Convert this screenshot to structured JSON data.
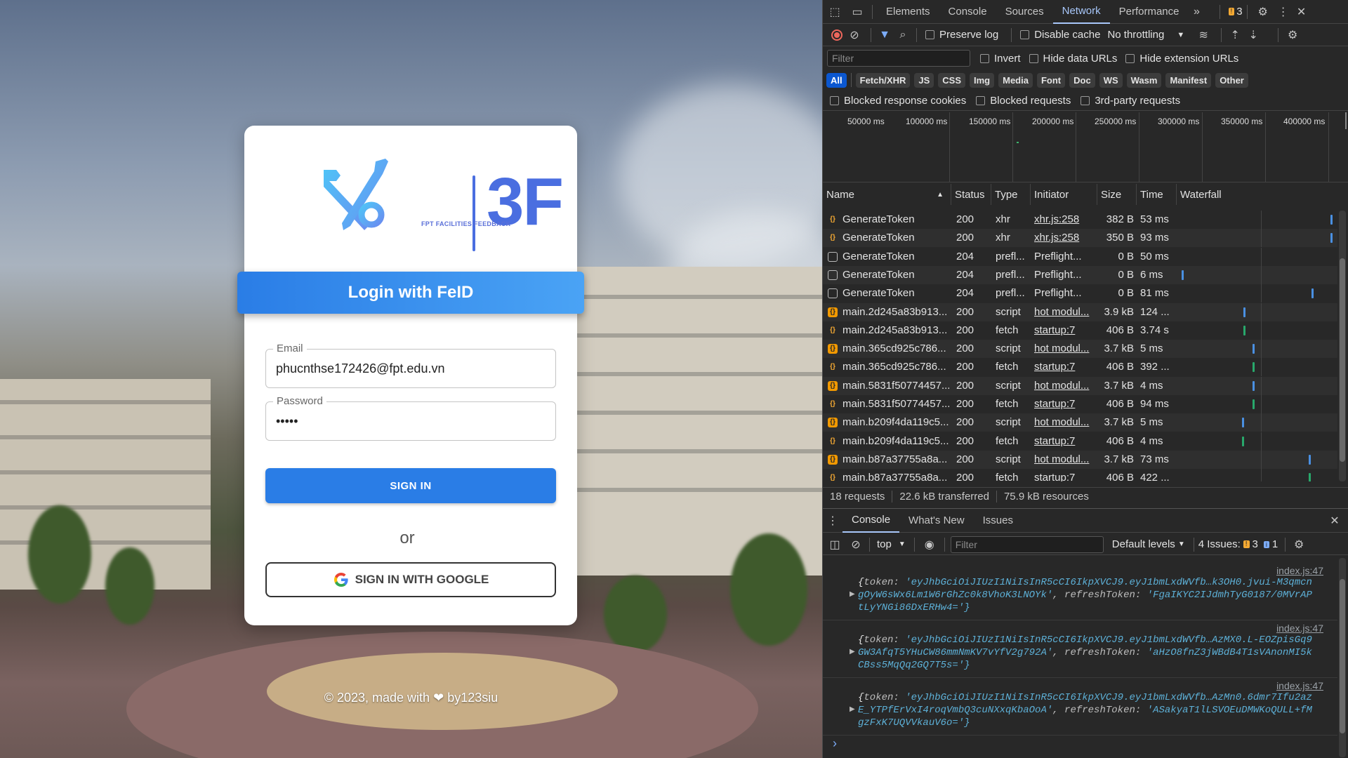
{
  "page": {
    "brand_logo": "3F",
    "brand_tagline": "FPT FACILITIES FEEDBACK",
    "banner_title": "Login with FeID",
    "email_label": "Email",
    "email_value": "phucnthse172426@fpt.edu.vn",
    "password_label": "Password",
    "password_value": "•••••",
    "signin_label": "SIGN IN",
    "or_text": "or",
    "google_label": "SIGN IN WITH GOOGLE",
    "footer_prefix": "© 2023, made with",
    "footer_suffix": "by123siu"
  },
  "devtools": {
    "tabs": [
      "Elements",
      "Console",
      "Sources",
      "Network",
      "Performance"
    ],
    "active_tab": "Network",
    "issues_count": "3",
    "toolbar": {
      "preserve_log": "Preserve log",
      "disable_cache": "Disable cache",
      "throttling": "No throttling"
    },
    "filter_placeholder": "Filter",
    "filter_options": {
      "invert": "Invert",
      "hide_data_urls": "Hide data URLs",
      "hide_extension_urls": "Hide extension URLs"
    },
    "type_chips": [
      "All",
      "Fetch/XHR",
      "JS",
      "CSS",
      "Img",
      "Media",
      "Font",
      "Doc",
      "WS",
      "Wasm",
      "Manifest",
      "Other"
    ],
    "request_options": {
      "blocked_cookies": "Blocked response cookies",
      "blocked_requests": "Blocked requests",
      "third_party": "3rd-party requests"
    },
    "timeline_ticks": [
      "50000 ms",
      "100000 ms",
      "150000 ms",
      "200000 ms",
      "250000 ms",
      "300000 ms",
      "350000 ms",
      "400000 ms"
    ],
    "columns": [
      "Name",
      "Status",
      "Type",
      "Initiator",
      "Size",
      "Time",
      "Waterfall"
    ],
    "rows": [
      {
        "name": "GenerateToken",
        "status": "200",
        "type": "xhr",
        "initiator": "xhr.js:258",
        "size": "382 B",
        "time": "53 ms",
        "icon": "xhr",
        "wf": 0.99
      },
      {
        "name": "GenerateToken",
        "status": "200",
        "type": "xhr",
        "initiator": "xhr.js:258",
        "size": "350 B",
        "time": "93 ms",
        "icon": "xhr",
        "wf": 0.99
      },
      {
        "name": "GenerateToken",
        "status": "204",
        "type": "prefl...",
        "initiator": "Preflight...",
        "size": "0 B",
        "time": "50 ms",
        "icon": "doc",
        "wf": null
      },
      {
        "name": "GenerateToken",
        "status": "204",
        "type": "prefl...",
        "initiator": "Preflight...",
        "size": "0 B",
        "time": "6 ms",
        "icon": "doc",
        "wf": 0.03
      },
      {
        "name": "GenerateToken",
        "status": "204",
        "type": "prefl...",
        "initiator": "Preflight...",
        "size": "0 B",
        "time": "81 ms",
        "icon": "doc",
        "wf": 0.87
      },
      {
        "name": "main.2d245a83b913...",
        "status": "200",
        "type": "script",
        "initiator": "hot modul...",
        "size": "3.9 kB",
        "time": "124 ...",
        "icon": "script",
        "wf": 0.43
      },
      {
        "name": "main.2d245a83b913...",
        "status": "200",
        "type": "fetch",
        "initiator": "startup:7",
        "size": "406 B",
        "time": "3.74 s",
        "icon": "xhr",
        "wf": 0.43
      },
      {
        "name": "main.365cd925c786...",
        "status": "200",
        "type": "script",
        "initiator": "hot modul...",
        "size": "3.7 kB",
        "time": "5 ms",
        "icon": "script",
        "wf": 0.49
      },
      {
        "name": "main.365cd925c786...",
        "status": "200",
        "type": "fetch",
        "initiator": "startup:7",
        "size": "406 B",
        "time": "392 ...",
        "icon": "xhr",
        "wf": 0.49
      },
      {
        "name": "main.5831f50774457...",
        "status": "200",
        "type": "script",
        "initiator": "hot modul...",
        "size": "3.7 kB",
        "time": "4 ms",
        "icon": "script",
        "wf": 0.49
      },
      {
        "name": "main.5831f50774457...",
        "status": "200",
        "type": "fetch",
        "initiator": "startup:7",
        "size": "406 B",
        "time": "94 ms",
        "icon": "xhr",
        "wf": 0.49
      },
      {
        "name": "main.b209f4da119c5...",
        "status": "200",
        "type": "script",
        "initiator": "hot modul...",
        "size": "3.7 kB",
        "time": "5 ms",
        "icon": "script",
        "wf": 0.42
      },
      {
        "name": "main.b209f4da119c5...",
        "status": "200",
        "type": "fetch",
        "initiator": "startup:7",
        "size": "406 B",
        "time": "4 ms",
        "icon": "xhr",
        "wf": 0.42
      },
      {
        "name": "main.b87a37755a8a...",
        "status": "200",
        "type": "script",
        "initiator": "hot modul...",
        "size": "3.7 kB",
        "time": "73 ms",
        "icon": "script",
        "wf": 0.85
      },
      {
        "name": "main.b87a37755a8a...",
        "status": "200",
        "type": "fetch",
        "initiator": "startup:7",
        "size": "406 B",
        "time": "422 ...",
        "icon": "xhr",
        "wf": 0.85
      }
    ],
    "summary": {
      "requests": "18 requests",
      "transferred": "22.6 kB transferred",
      "resources": "75.9 kB resources"
    },
    "drawer": {
      "tabs": [
        "Console",
        "What's New",
        "Issues"
      ],
      "context": "top",
      "filter_placeholder": "Filter",
      "levels": "Default levels",
      "issues_label": "4 Issues:",
      "warn_count": "3",
      "info_count": "1"
    },
    "logs": [
      {
        "src": "index.js:47",
        "line1_token": "'eyJhbGciOiJIUzI1NiIsInR5cCI6IkpXVCJ9.eyJ1bmLxdWVfb…k3OH0.jvui-M3qmcn",
        "line2_token": "gOyW6sWx6Lm1W6rGhZc0k8VhoK3LNOYk'",
        "line2_refresh": "'FgaIKYC2IJdmhTyG0187/0MVrAP",
        "line3": "tLyYNGi86DxERHw4='}"
      },
      {
        "src": "index.js:47",
        "line1_token": "'eyJhbGciOiJIUzI1NiIsInR5cCI6IkpXVCJ9.eyJ1bmLxdWVfb…AzMX0.L-EOZpisGq9",
        "line2_token": "GW3AfqT5YHuCW86mmNmKV7vYfV2g792A'",
        "line2_refresh": "'aHzO8fnZ3jWBdB4T1sVAnonMI5k",
        "line3": "CBss5MqQq2GQ7T5s='}"
      },
      {
        "src": "index.js:47",
        "line1_token": "'eyJhbGciOiJIUzI1NiIsInR5cCI6IkpXVCJ9.eyJ1bmLxdWVfb…AzMn0.6dmr7Ifu2az",
        "line2_token": "E_YTPfErVxI4roqVmbQ3cuNXxqKbaOoA'",
        "line2_refresh": "'ASakyaT1lLSVOEuDMWKoQULL+fM",
        "line3": "gzFxK7UQVVkauV6o='}"
      }
    ]
  }
}
